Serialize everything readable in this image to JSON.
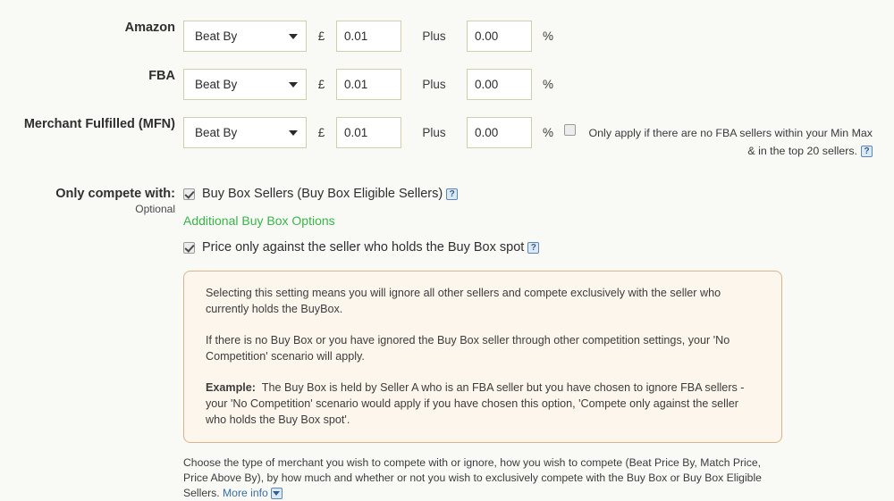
{
  "rows": [
    {
      "label": "Amazon",
      "strategy": "Beat By",
      "currency_symbol": "£",
      "amount": "0.01",
      "plus_label": "Plus",
      "percent": "0.00",
      "percent_symbol": "%"
    },
    {
      "label": "FBA",
      "strategy": "Beat By",
      "currency_symbol": "£",
      "amount": "0.01",
      "plus_label": "Plus",
      "percent": "0.00",
      "percent_symbol": "%"
    },
    {
      "label": "Merchant Fulfilled (MFN)",
      "strategy": "Beat By",
      "currency_symbol": "£",
      "amount": "0.01",
      "plus_label": "Plus",
      "percent": "0.00",
      "percent_symbol": "%",
      "note_checked": false,
      "note_text": "Only apply if there are no FBA sellers within your Min Max & in the top 20 sellers.",
      "note_help": "?"
    }
  ],
  "compete": {
    "label": "Only compete with:",
    "optional": "Optional",
    "buybox_sellers_checked": true,
    "buybox_sellers_label": "Buy Box Sellers (Buy Box Eligible Sellers)",
    "buybox_sellers_help": "?",
    "additional_options_link": "Additional Buy Box Options",
    "price_only_checked": true,
    "price_only_label": "Price only against the seller who holds the Buy Box spot",
    "price_only_help": "?"
  },
  "info_panel": {
    "paragraph_1": "Selecting this setting means you will ignore all other sellers and compete exclusively with the seller who currently holds the BuyBox.",
    "paragraph_2": "If there is no Buy Box or you have ignored the Buy Box seller through other competition settings, your 'No Competition' scenario will apply.",
    "example_label": "Example:",
    "example_text": "The Buy Box is held by Seller A who is an FBA seller but you have chosen to ignore FBA sellers - your 'No Competition' scenario would apply if you have chosen this option, 'Compete only against the seller who holds the Buy Box spot'."
  },
  "footer": {
    "text": "Choose the type of merchant you wish to compete with or ignore, how you wish to compete (Beat Price By, Match Price, Price Above By), by how much and whether or not you wish to exclusively compete with the Buy Box or Buy Box Eligible Sellers.",
    "more_info_link": "More info"
  },
  "colors": {
    "background": "#f9f9f5",
    "green_link": "#39b54a",
    "blue_link": "#3a6ea5",
    "panel_bg": "#fdf6ec",
    "panel_border": "#ddb48a",
    "input_border": "#cfcfae"
  }
}
